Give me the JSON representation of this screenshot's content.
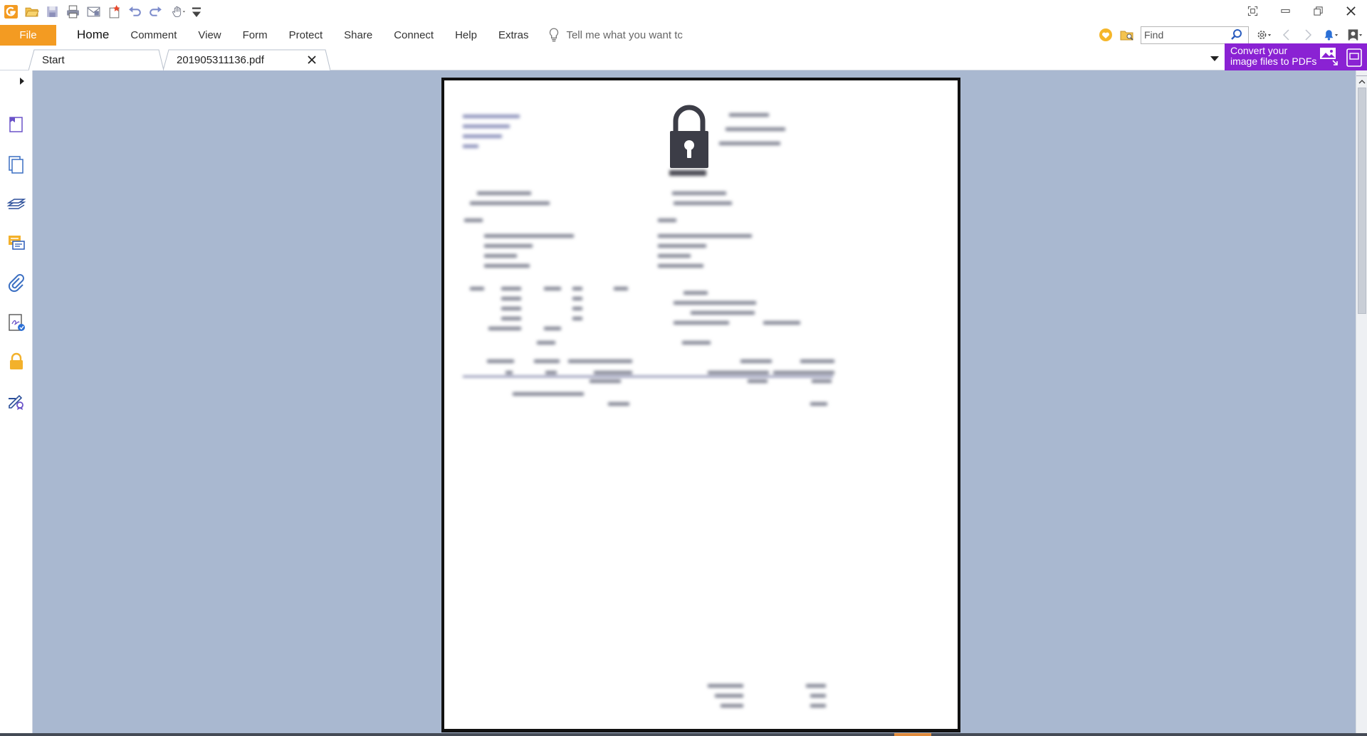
{
  "app": {
    "colors": {
      "accent": "#f39b22",
      "ad_purple": "#8a22d3",
      "canvas": "#a9b8d0"
    }
  },
  "quick_access": {
    "icons": [
      "app-logo-icon",
      "open-folder-icon",
      "save-icon",
      "print-icon",
      "email-icon",
      "new-icon",
      "undo-icon",
      "redo-icon",
      "hand-tool-icon",
      "customize-dropdown-icon"
    ]
  },
  "window_controls": {
    "icons": [
      "layout-icon",
      "minimize-icon",
      "restore-icon",
      "close-window-icon"
    ]
  },
  "menu": {
    "file_label": "File",
    "items": [
      "Home",
      "Comment",
      "View",
      "Form",
      "Protect",
      "Share",
      "Connect",
      "Help",
      "Extras"
    ],
    "active": "Home",
    "tell_me_placeholder": "Tell me what you want tc"
  },
  "search": {
    "placeholder": "Find"
  },
  "tabs": [
    {
      "label": "Start"
    },
    {
      "label": "201905311136.pdf"
    }
  ],
  "ad": {
    "line1": "Convert your",
    "line2": "image files to PDFs"
  },
  "side_panel": {
    "icons": [
      "bookmarks-icon",
      "pages-icon",
      "layers-icon",
      "comments-icon",
      "attachments-icon",
      "signature-panel-icon",
      "security-lock-icon",
      "digital-id-icon"
    ]
  },
  "document": {
    "locked": true
  }
}
